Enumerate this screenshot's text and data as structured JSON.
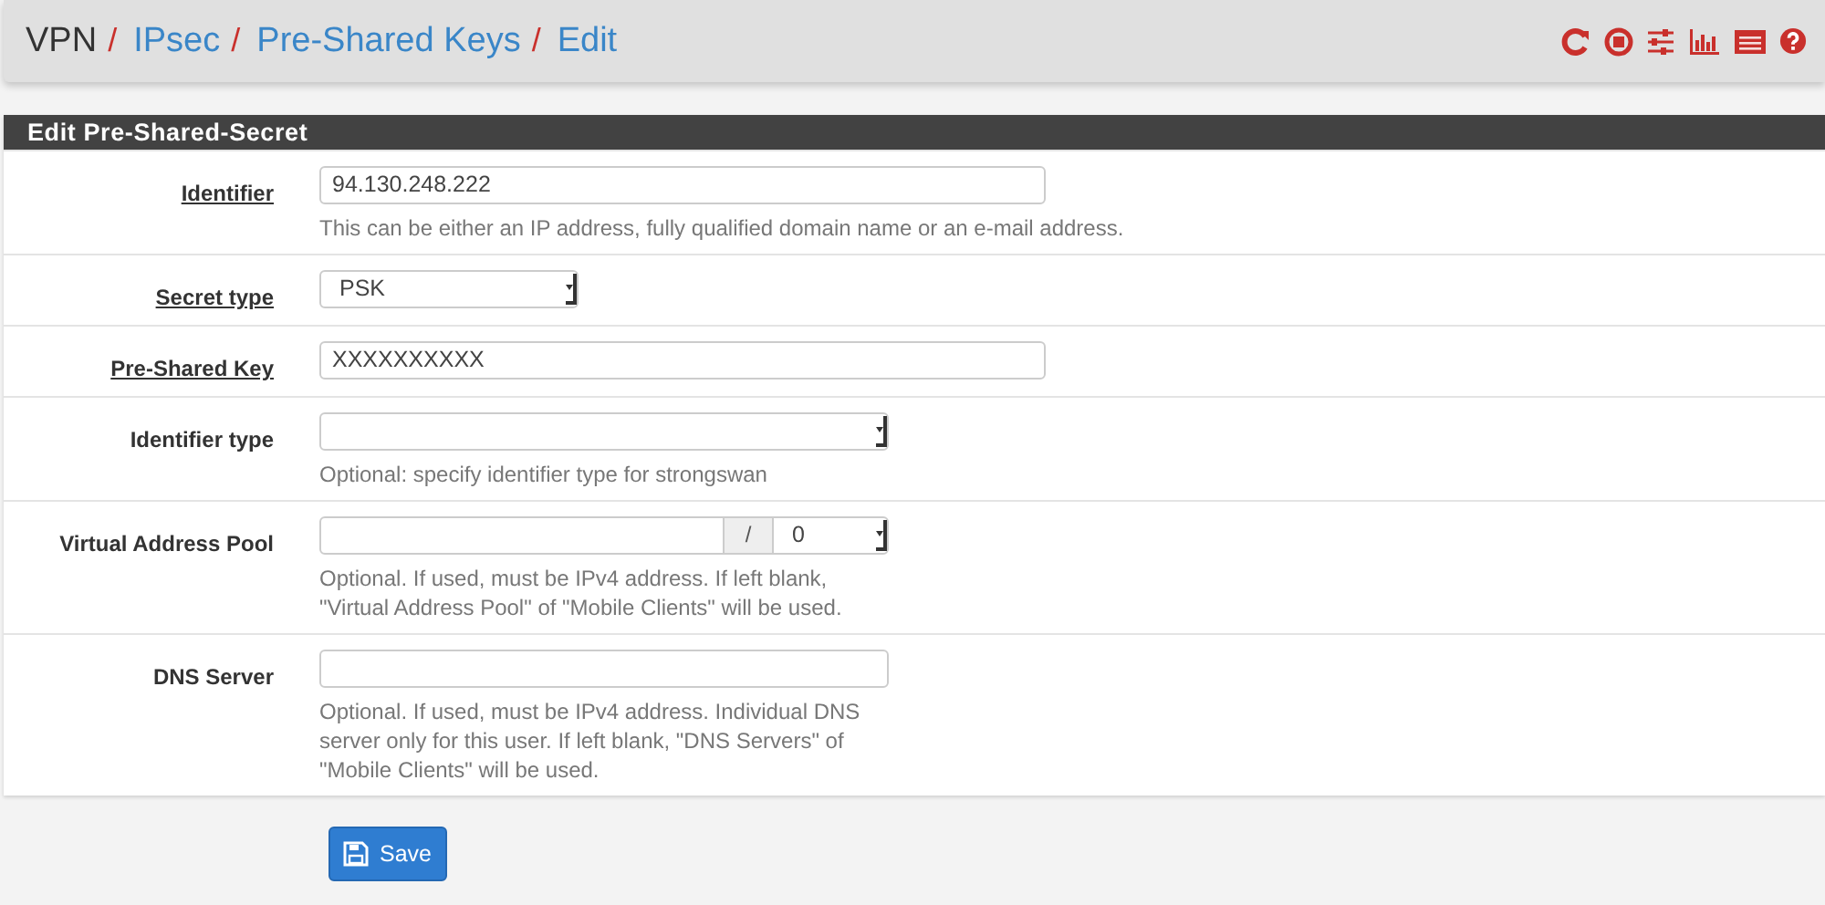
{
  "breadcrumb": [
    {
      "label": "VPN",
      "link": false,
      "separator": "/"
    },
    {
      "label": "IPsec",
      "link": true,
      "separator": "/"
    },
    {
      "label": "Pre-Shared Keys",
      "link": true,
      "separator": "/"
    },
    {
      "label": "Edit",
      "link": true
    }
  ],
  "panel": {
    "title": "Edit Pre-Shared-Secret"
  },
  "rows": [
    {
      "kind": "input",
      "label": "Identifier",
      "required": true,
      "value": "94.130.248.222",
      "help": [
        "This can be either an IP address, fully qualified domain name or an e-mail address."
      ]
    },
    {
      "kind": "select",
      "label": "Secret type",
      "required": true,
      "value": "PSK"
    },
    {
      "kind": "input",
      "label": "Pre-Shared Key",
      "required": true,
      "value": "XXXXXXXXXX"
    },
    {
      "kind": "select",
      "label": "Identifier type",
      "required": false,
      "help": [
        "Optional: specify identifier type for strongswan"
      ]
    },
    {
      "kind": "pool",
      "label": "Virtual Address Pool",
      "required": false,
      "separator": "/",
      "mask": "0",
      "help": [
        "Optional. If used, must be IPv4 address. If left blank,",
        "\"Virtual Address Pool\" of \"Mobile Clients\" will be used."
      ]
    },
    {
      "kind": "input",
      "label": "DNS Server",
      "required": false,
      "help": [
        "Optional. If used, must be IPv4 address. Individual DNS",
        "server only for this user. If left blank, \"DNS Servers\" of",
        "\"Mobile Clients\" will be used."
      ]
    }
  ],
  "save_button": {
    "label": "Save"
  }
}
